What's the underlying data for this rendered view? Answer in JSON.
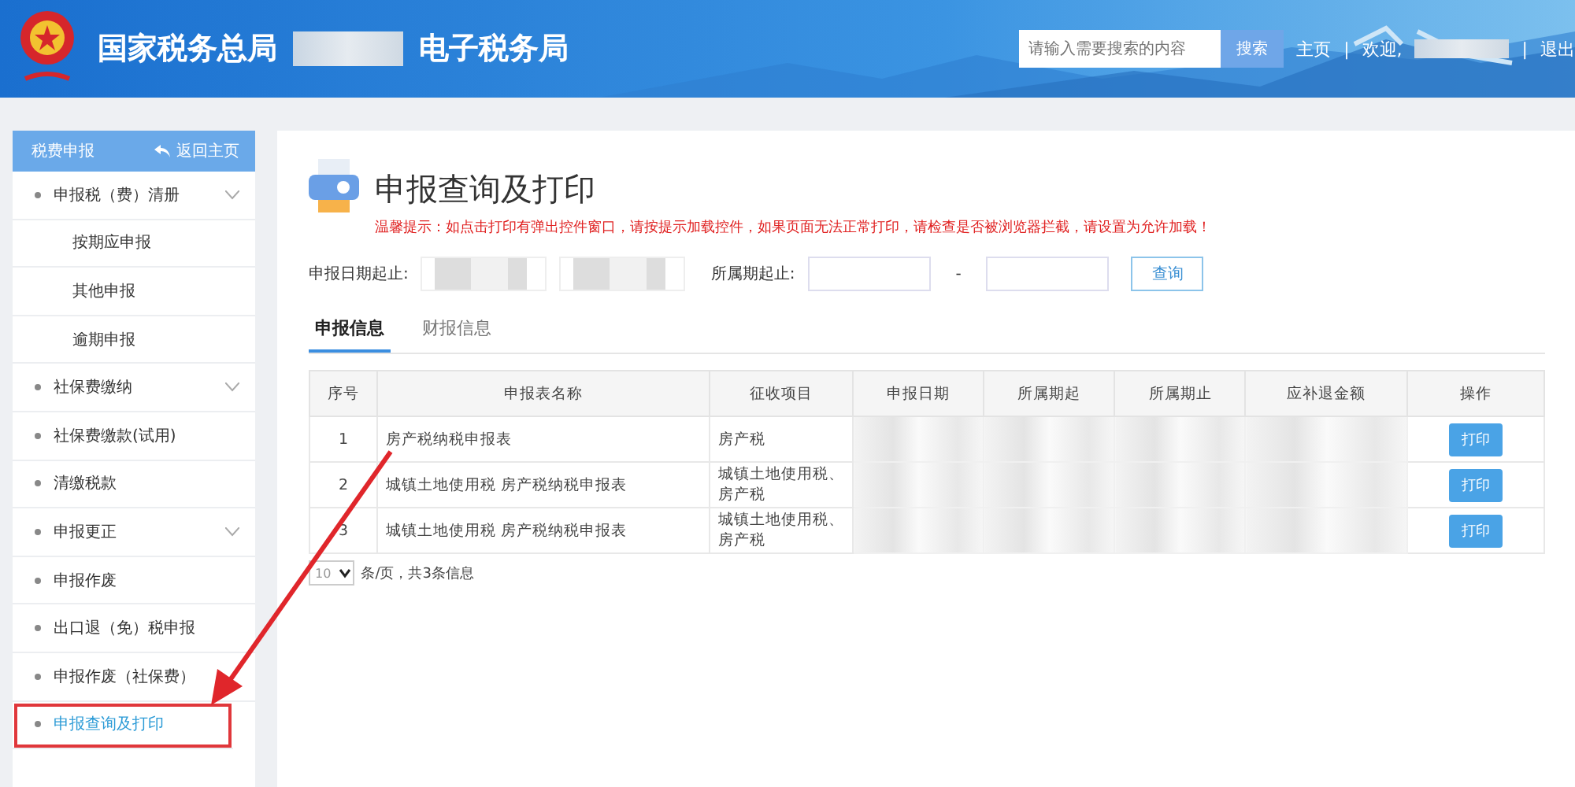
{
  "header": {
    "title": "国家税务总局",
    "title_suffix": "电子税务局",
    "search": {
      "placeholder": "请输入需要搜索的内容",
      "button": "搜索"
    },
    "links": [
      "主页",
      "欢迎,",
      "退出"
    ],
    "separator": "|"
  },
  "sidebar": {
    "title": "税费申报",
    "back": "返回主页",
    "items": [
      {
        "label": "申报税（费）清册",
        "kind": "group",
        "selected": false
      },
      {
        "label": "按期应申报",
        "kind": "sub",
        "selected": false
      },
      {
        "label": "其他申报",
        "kind": "sub",
        "selected": false
      },
      {
        "label": "逾期申报",
        "kind": "sub",
        "selected": false
      },
      {
        "label": "社保费缴纳",
        "kind": "group",
        "selected": false
      },
      {
        "label": "社保费缴款(试用)",
        "kind": "item",
        "selected": false
      },
      {
        "label": "清缴税款",
        "kind": "item",
        "selected": false
      },
      {
        "label": "申报更正",
        "kind": "group",
        "selected": false
      },
      {
        "label": "申报作废",
        "kind": "item",
        "selected": false
      },
      {
        "label": "出口退（免）税申报",
        "kind": "item",
        "selected": false
      },
      {
        "label": "申报作废（社保费）",
        "kind": "item",
        "selected": false
      },
      {
        "label": "申报查询及打印",
        "kind": "item",
        "selected": true
      }
    ]
  },
  "page": {
    "title": "申报查询及打印",
    "notice": "温馨提示：如点击打印有弹出控件窗口，请按提示加载控件，如果页面无法正常打印，请检查是否被浏览器拦截，请设置为允许加载！",
    "filters": {
      "date_label": "申报日期起止:",
      "period_label": "所属期起止:",
      "separator": "-",
      "query": "查询"
    },
    "tabs": [
      {
        "label": "申报信息",
        "selected": true
      },
      {
        "label": "财报信息",
        "selected": false
      }
    ],
    "table": {
      "columns": [
        "序号",
        "申报表名称",
        "征收项目",
        "申报日期",
        "所属期起",
        "所属期止",
        "应补退金额",
        "操作"
      ],
      "rows": [
        {
          "no": "1",
          "name": "房产税纳税申报表",
          "item": "房产税",
          "action": "打印"
        },
        {
          "no": "2",
          "name": "城镇土地使用税 房产税纳税申报表",
          "item": "城镇土地使用税、房产税",
          "action": "打印"
        },
        {
          "no": "3",
          "name": "城镇土地使用税 房产税纳税申报表",
          "item": "城镇土地使用税、房产税",
          "action": "打印"
        }
      ]
    },
    "pager": {
      "size": "10",
      "summary": "条/页，共3条信息"
    }
  }
}
